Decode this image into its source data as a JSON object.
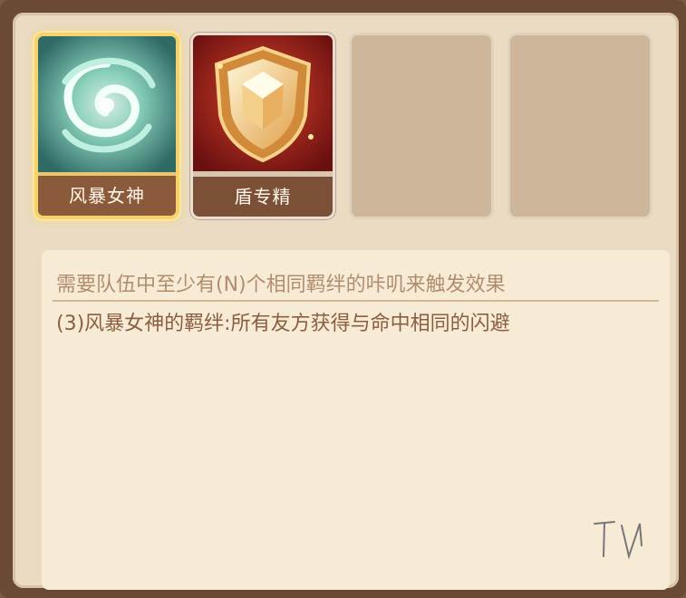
{
  "cards": [
    {
      "label": "风暴女神",
      "icon": "storm-goddess-icon",
      "state": "selected"
    },
    {
      "label": "盾专精",
      "icon": "shield-mastery-icon",
      "state": "normal"
    },
    {
      "label": "",
      "icon": "",
      "state": "empty"
    },
    {
      "label": "",
      "icon": "",
      "state": "empty"
    }
  ],
  "description": {
    "requirement": "需要队伍中至少有(N)个相同羁绊的咔叽来触发效果",
    "bond_effect": "(3)风暴女神的羁绊:所有友方获得与命中相同的闪避"
  },
  "signature": "TV",
  "colors": {
    "frame": "#6b4a35",
    "panel": "#eadbc2",
    "card_label": "#8a5a3b",
    "selected_border": "#f6d36a",
    "requirement_text": "#b08d6e",
    "effect_text": "#8a5f40"
  }
}
